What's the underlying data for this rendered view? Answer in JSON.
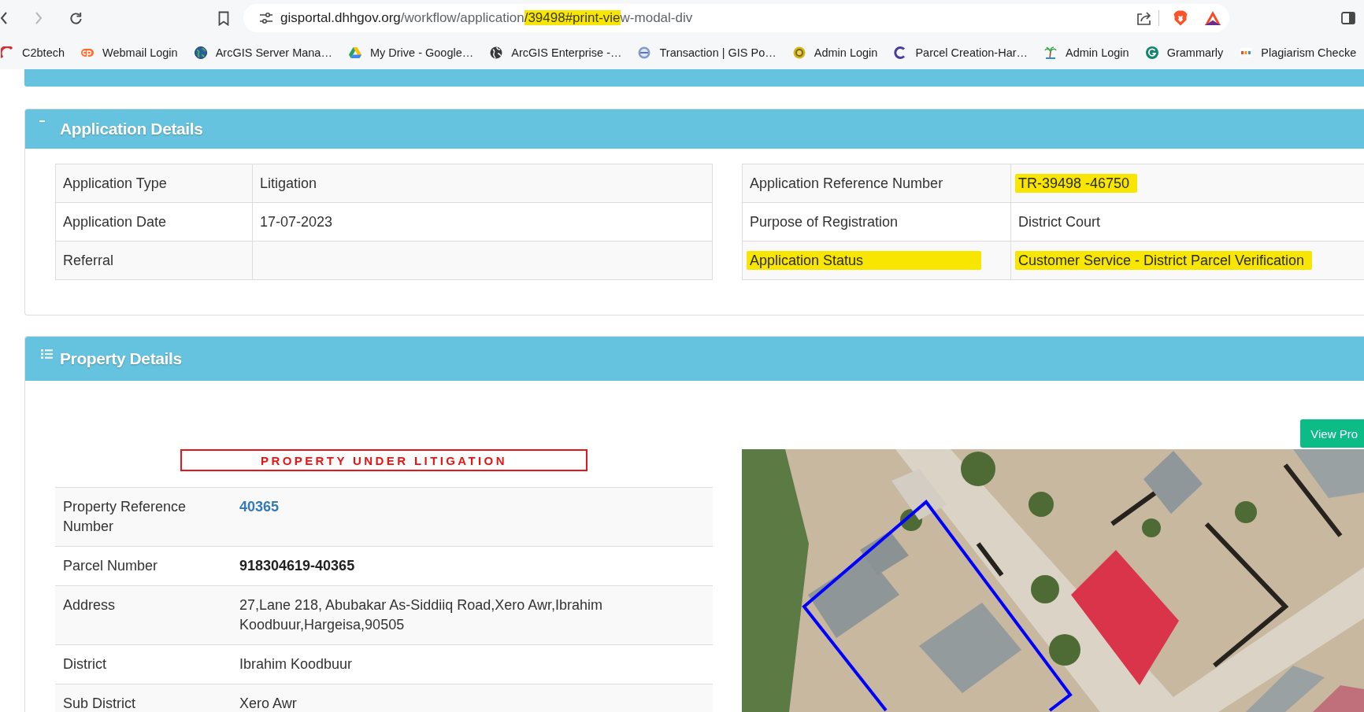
{
  "address_bar": {
    "url_parts": [
      {
        "text": "gisportal.dhhgov.org",
        "kind": "host",
        "highlighted": false
      },
      {
        "text": "/workflow/application",
        "kind": "path",
        "highlighted": false
      },
      {
        "text": "/39498#print-vie",
        "kind": "path",
        "highlighted": true
      },
      {
        "text": "w-modal-div",
        "kind": "path",
        "highlighted": false
      }
    ]
  },
  "bookmarks": [
    {
      "label": "C2btech"
    },
    {
      "label": "Webmail Login"
    },
    {
      "label": "ArcGIS Server Mana…"
    },
    {
      "label": "My Drive - Google…"
    },
    {
      "label": "ArcGIS Enterprise -…"
    },
    {
      "label": "Transaction | GIS Po…"
    },
    {
      "label": "Admin Login"
    },
    {
      "label": "Parcel Creation-Har…"
    },
    {
      "label": "Admin Login"
    },
    {
      "label": "Grammarly"
    },
    {
      "label": "Plagiarism Checke"
    }
  ],
  "application_details": {
    "title": "Application Details",
    "expanded": true,
    "left_table": [
      {
        "label": "Application Type",
        "value": "Litigation"
      },
      {
        "label": "Application Date",
        "value": "17-07-2023"
      },
      {
        "label": "Referral"
      }
    ],
    "right_table": [
      {
        "label": "Application Reference Number",
        "value": "TR-39498 -46750",
        "label_highlighted": false,
        "value_highlighted": true
      },
      {
        "label": "Purpose of Registration",
        "value": "District Court",
        "label_highlighted": false,
        "value_highlighted": false
      },
      {
        "label": "Application Status",
        "value": "Customer Service - District Parcel Verification",
        "label_highlighted": true,
        "value_highlighted": true
      }
    ]
  },
  "property_details": {
    "title": "Property Details",
    "view_button": "View Pro",
    "notice": "PROPERTY UNDER LITIGATION",
    "rows": [
      {
        "label": "Property Reference Number",
        "value": "40365",
        "kind": "link"
      },
      {
        "label": "Parcel Number",
        "value": "918304619-40365",
        "kind": "bold"
      },
      {
        "label": "Address",
        "value": "27,Lane 218, Abubakar As-Siddiiq Road,Xero Awr,Ibrahim Koodbuur,Hargeisa,90505",
        "kind": "text"
      },
      {
        "label": "District",
        "value": "Ibrahim Koodbuur",
        "kind": "text"
      },
      {
        "label": "Sub District",
        "value": "Xero Awr",
        "kind": "text"
      }
    ]
  }
}
